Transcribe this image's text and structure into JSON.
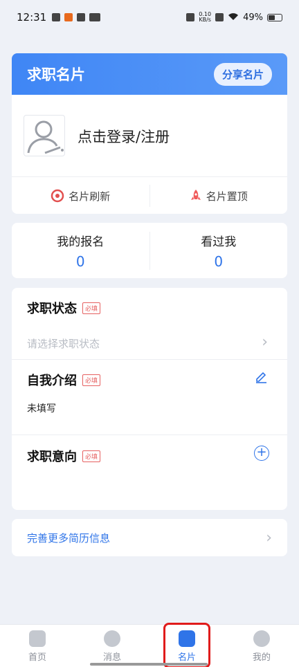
{
  "status_bar": {
    "time": "12:31",
    "net_speed": "0.10",
    "net_unit": "KB/s",
    "battery": "49%"
  },
  "header": {
    "title": "求职名片",
    "share_label": "分享名片"
  },
  "profile": {
    "login_text": "点击登录/注册",
    "refresh_label": "名片刷新",
    "pin_label": "名片置顶"
  },
  "stats": [
    {
      "label": "我的报名",
      "value": "0"
    },
    {
      "label": "看过我",
      "value": "0"
    }
  ],
  "form": {
    "status": {
      "title": "求职状态",
      "required": "必填",
      "placeholder": "请选择求职状态"
    },
    "intro": {
      "title": "自我介绍",
      "required": "必填",
      "value": "未填写"
    },
    "intent": {
      "title": "求职意向",
      "required": "必填"
    }
  },
  "more": {
    "label": "完善更多简历信息"
  },
  "tabs": [
    {
      "label": "首页",
      "icon": "home-icon"
    },
    {
      "label": "消息",
      "icon": "message-icon"
    },
    {
      "label": "名片",
      "icon": "card-icon"
    },
    {
      "label": "我的",
      "icon": "profile-icon"
    }
  ],
  "colors": {
    "accent": "#2f74e8",
    "header_gradient_start": "#3f86f5",
    "required": "#e66060",
    "highlight": "#e01b1b"
  }
}
